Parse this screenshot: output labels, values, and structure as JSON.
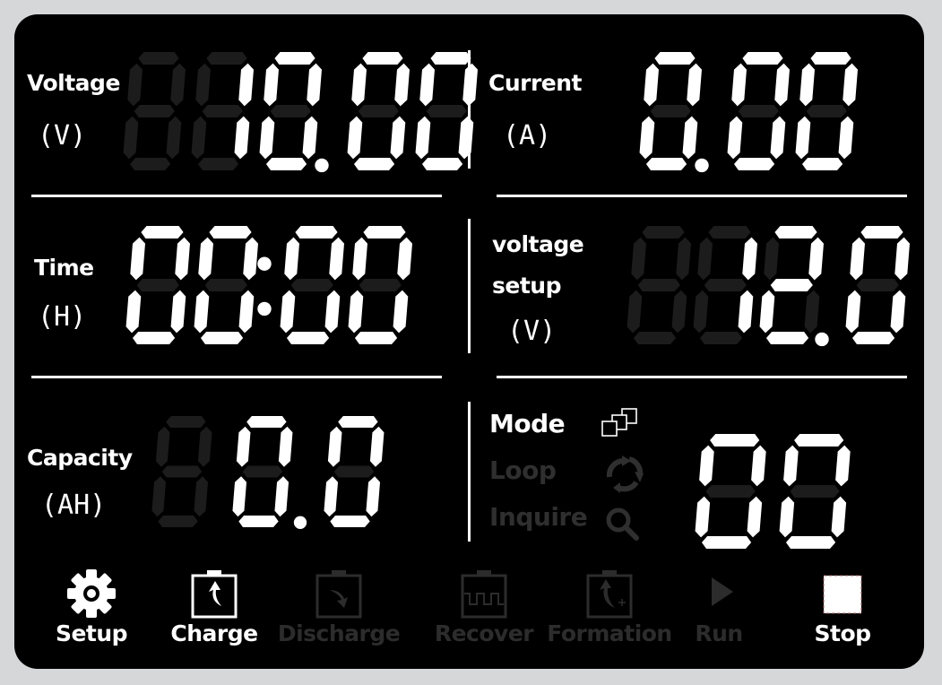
{
  "colors": {
    "lit": "#ffffff",
    "unlit": "#1c1c1c",
    "disabled": "#2c2c2c",
    "background": "#000000",
    "frame": "#d6d7d8"
  },
  "voltage": {
    "label": "Voltage",
    "unit": "(V)",
    "value": "10.00",
    "digits": " 0.00",
    "digit_mask": [
      0,
      1,
      1,
      1,
      1
    ]
  },
  "current": {
    "label": "Current",
    "unit": "(A)",
    "value": "0.00"
  },
  "time": {
    "label": "Time",
    "unit": "(H)",
    "value": "00:00"
  },
  "voltage_setup": {
    "label_line1": "voltage",
    "label_line2": "setup",
    "unit": "(V)",
    "value": "12.0"
  },
  "capacity": {
    "label": "Capacity",
    "unit": "(AH)",
    "value": "0.0"
  },
  "mode": {
    "items": [
      {
        "label": "Mode",
        "icon": "layers-icon",
        "active": true
      },
      {
        "label": "Loop",
        "icon": "loop-icon",
        "active": false
      },
      {
        "label": "Inquire",
        "icon": "search-icon",
        "active": false
      }
    ],
    "value": "00"
  },
  "toolbar": [
    {
      "label": "Setup",
      "icon": "gear-icon",
      "enabled": true
    },
    {
      "label": "Charge",
      "icon": "battery-charge-icon",
      "enabled": true
    },
    {
      "label": "Discharge",
      "icon": "battery-discharge-icon",
      "enabled": false
    },
    {
      "label": "Recover",
      "icon": "battery-recover-icon",
      "enabled": false
    },
    {
      "label": "Formation",
      "icon": "battery-formation-icon",
      "enabled": false
    },
    {
      "label": "Run",
      "icon": "play-icon",
      "enabled": false
    },
    {
      "label": "Stop",
      "icon": "stop-icon",
      "enabled": true
    }
  ]
}
